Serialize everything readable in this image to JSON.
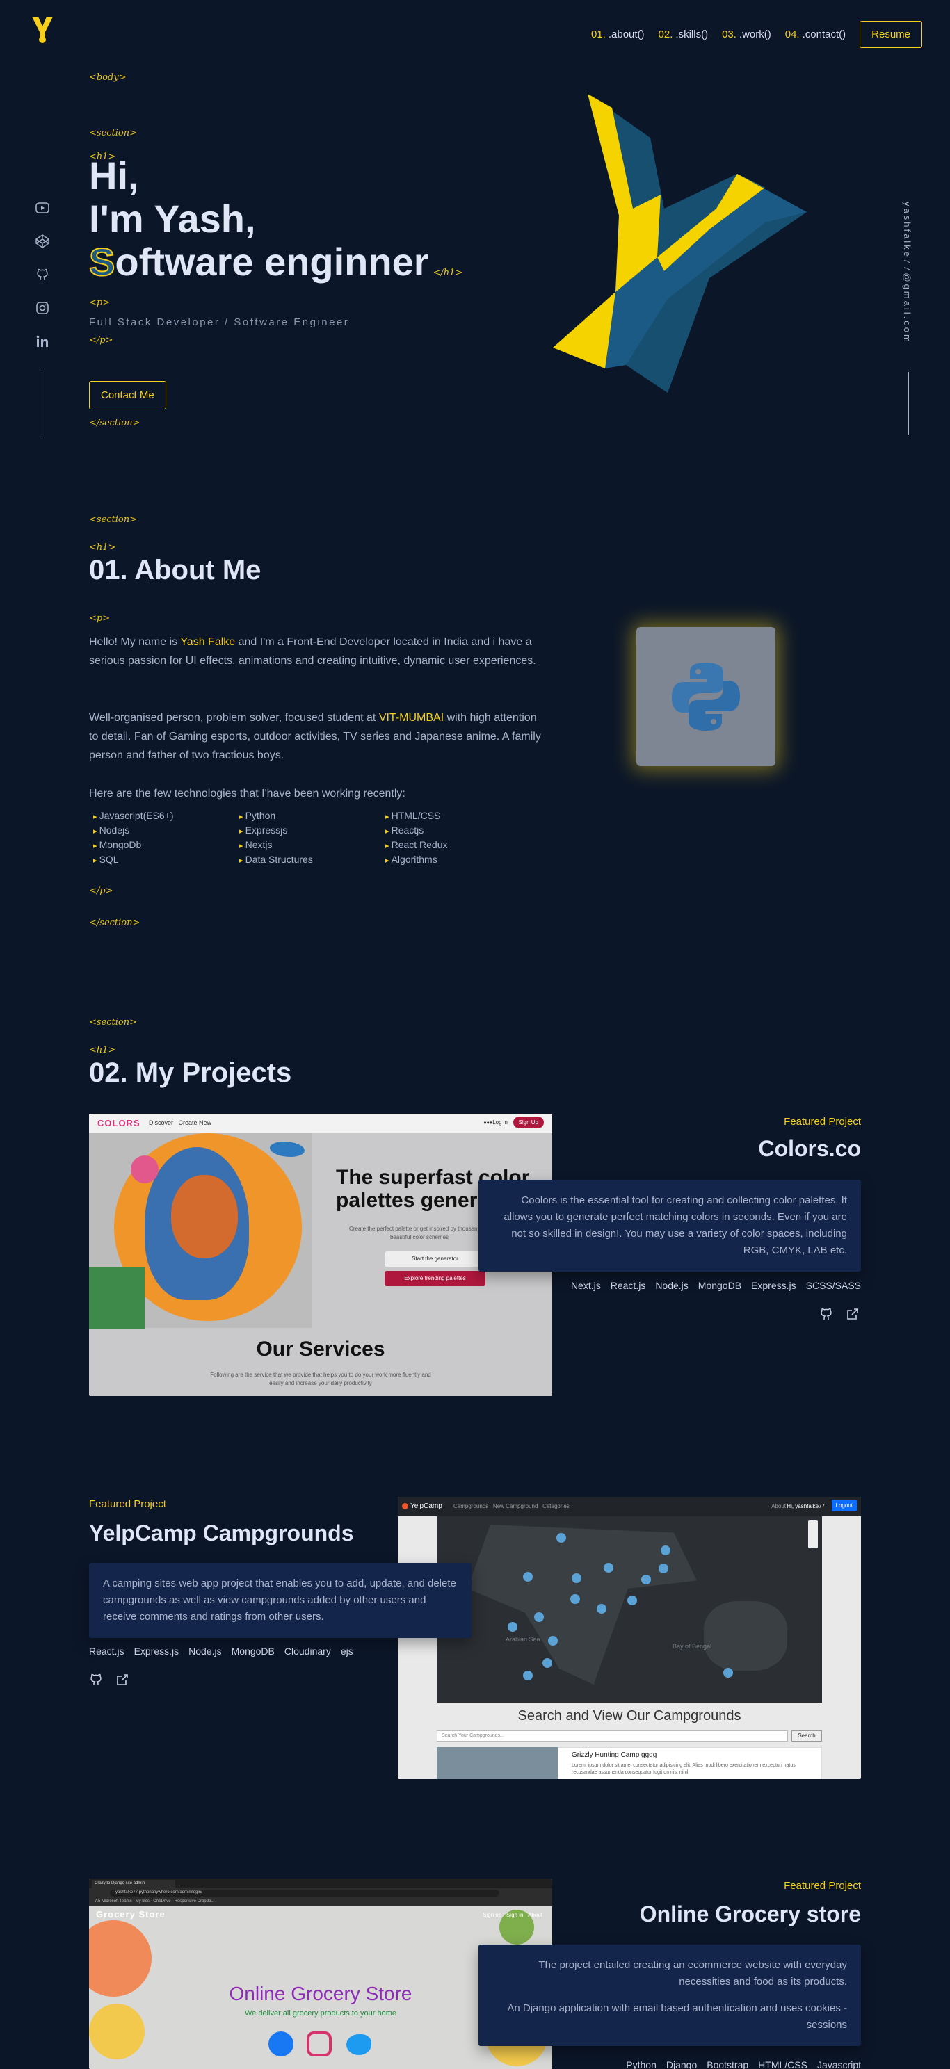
{
  "header": {
    "nav": [
      {
        "num": "01.",
        "label": ".about()"
      },
      {
        "num": "02.",
        "label": ".skills()"
      },
      {
        "num": "03.",
        "label": ".work()"
      },
      {
        "num": "04.",
        "label": ".contact()"
      }
    ],
    "resume_label": "Resume"
  },
  "side": {
    "icons": [
      "youtube-icon",
      "codepen-icon",
      "github-icon",
      "instagram-icon",
      "linkedin-icon"
    ],
    "email": "yashfalke77@gmail.com"
  },
  "tags": {
    "body": "<body>",
    "section": "<section>",
    "section_close": "</section>",
    "h1": "<h1>",
    "h1_close": "</h1>",
    "p": "<p>",
    "p_close": "</p>"
  },
  "hero": {
    "line1": "Hi,",
    "line2": "I'm Yash,",
    "line3_first": "S",
    "line3_rest": "oftware enginner",
    "subtitle": "Full Stack Developer / Software Engineer",
    "contact_label": "Contact Me"
  },
  "about": {
    "heading": "01. About Me",
    "p1_a": "Hello! My name is ",
    "p1_name": "Yash Falke",
    "p1_b": " and I'm a Front-End Developer located in India and i have a serious passion for UI effects, animations and creating intuitive, dynamic user experiences.",
    "p2_a": "Well-organised person, problem solver, focused student at ",
    "p2_school": "VIT-MUMBAI",
    "p2_b": " with high attention to detail. Fan of Gaming esports, outdoor activities, TV series and Japanese anime. A family person and father of two fractious boys.",
    "p3": "Here are the few technologies that I'have been working recently:",
    "techs": [
      "Javascript(ES6+)",
      "Python",
      "HTML/CSS",
      "Nodejs",
      "Expressjs",
      "Reactjs",
      "MongoDb",
      "Nextjs",
      "React Redux",
      "SQL",
      "Data Structures",
      "Algorithms"
    ]
  },
  "projects": {
    "heading": "02. My Projects",
    "featured_label": "Featured Project",
    "items": [
      {
        "name": "Colors.co",
        "desc": "Coolors is the essential tool for creating and collecting color palettes. It allows you to generate perfect matching colors in seconds. Even if you are not so skilled in design!. You may use a variety of color spaces, including RGB, CMYK, LAB etc.",
        "stack": [
          "Next.js",
          "React.js",
          "Node.js",
          "MongoDB",
          "Express.js",
          "SCSS/SASS"
        ],
        "shot": {
          "logo": "COLORS",
          "nav": [
            "Discover",
            "Create New"
          ],
          "login": "Log in",
          "signup": "Sign Up",
          "hero_title": "The superfast color palettes generator!",
          "hero_text": "Create the perfect palette or get inspired by thousands of beautiful color schemes",
          "btn1": "Start the generator",
          "btn2": "Explore trending palettes",
          "services_title": "Our Services",
          "services_text": "Following are the service that we provide that helps you to do your work more fluently and easily and increase your daily productivity"
        }
      },
      {
        "name": "YelpCamp Campgrounds",
        "desc": "A camping sites web app project that enables you to add, update, and delete campgrounds as well as view campgrounds added by other users and receive comments and ratings from other users.",
        "stack": [
          "React.js",
          "Express.js",
          "Node.js",
          "MongoDB",
          "Cloudinary",
          "ejs"
        ],
        "shot": {
          "brand": "YelpCamp",
          "nav": [
            "Campgrounds",
            "New Campground",
            "Categories"
          ],
          "about": "About",
          "user": "Hi, yashfalke77",
          "logout": "Logout",
          "map_labels": [
            "Arabian Sea",
            "Bay of Bengal"
          ],
          "search_title": "Search and View Our Campgrounds",
          "search_placeholder": "Search Your Campgrounds...",
          "search_btn": "Search",
          "card_title": "Grizzly Hunting Camp gggg",
          "card_text": "Lorem, ipsum dolor sit amet consectetur adipisicing elit. Alias modi libero exercitationem excepturi natus recusandae assumenda consequatur fugit omnis, nihil"
        }
      },
      {
        "name": "Online Grocery store",
        "desc1": "The project entailed creating an ecommerce website with everyday necessities and food as its products.",
        "desc2": "An Django application with email based authentication and uses cookies - sessions",
        "stack": [
          "Python",
          "Django",
          "Bootstrap",
          "HTML/CSS",
          "Javascript"
        ],
        "shot": {
          "tab": "Crazy to Django site admin",
          "url": "yashfalke77.pythonanywhere.com/admin/login/",
          "bookmarks": [
            "7.5 Microsoft Teams",
            "My files - OneDrive",
            "Responsive Dropdo..."
          ],
          "brand": "Grocery Store",
          "nav": [
            "Sign up",
            "Sign in",
            "About"
          ],
          "title": "Online Grocery Store",
          "subtitle": "We deliver all grocery products to your home"
        }
      }
    ]
  },
  "colors": {
    "bg": "#0b1628",
    "accent": "#f5cf1b",
    "heading": "#dfe6f6",
    "text": "#a9b4cc",
    "card": "#13254a"
  }
}
